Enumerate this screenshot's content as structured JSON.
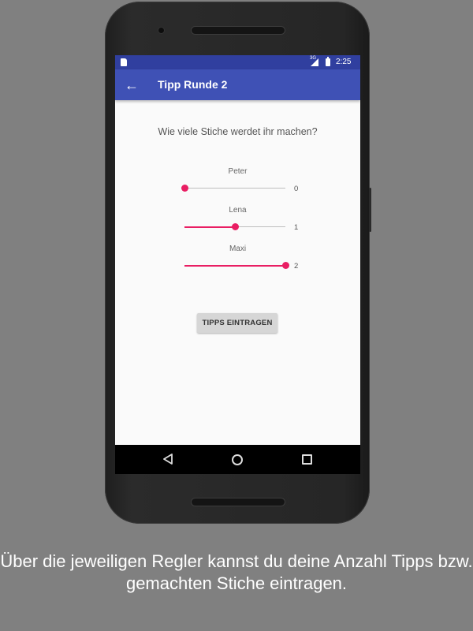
{
  "status_bar": {
    "network": "3G",
    "time": "2:25",
    "icons": [
      "sd-card-icon",
      "signal-icon",
      "battery-icon"
    ]
  },
  "app_bar": {
    "back_icon": "arrow-back-icon",
    "title": "Tipp Runde 2"
  },
  "main": {
    "question": "Wie viele Stiche werdet ihr machen?",
    "players": [
      {
        "name": "Peter",
        "value": "0",
        "fraction": 0.0
      },
      {
        "name": "Lena",
        "value": "1",
        "fraction": 0.5
      },
      {
        "name": "Maxi",
        "value": "2",
        "fraction": 1.0
      }
    ],
    "submit_label": "TIPPS EINTRAGEN"
  },
  "nav_bar": {
    "icons": [
      "nav-back-icon",
      "nav-home-icon",
      "nav-recents-icon"
    ]
  },
  "caption": "Über die jeweiligen Regler kannst du deine Anzahl Tipps bzw. gemachten Stiche eintragen.",
  "colors": {
    "primary": "#3f51b5",
    "primary_dark": "#303f9f",
    "accent": "#e91e63",
    "background": "#808080"
  }
}
